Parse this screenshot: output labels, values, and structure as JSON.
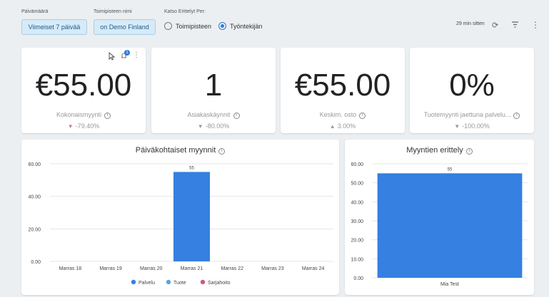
{
  "filters": {
    "date": {
      "label": "Päivämäärä",
      "value": "Viimeiset 7 päivää"
    },
    "location": {
      "label": "Toimipisteen nimi",
      "value": "on Demo Finland"
    },
    "breakdown": {
      "label": "Katso Erittelyt Per:",
      "options": [
        {
          "label": "Toimipisteen",
          "selected": false
        },
        {
          "label": "Työntekijän",
          "selected": true
        }
      ]
    },
    "updated": "29 min sitten"
  },
  "kpis": [
    {
      "value": "€55.00",
      "label": "Kokonaismyynti",
      "delta": "-79.40%",
      "direction": "down"
    },
    {
      "value": "1",
      "label": "Asiakaskäynnit",
      "delta": "-80.00%",
      "direction": "down"
    },
    {
      "value": "€55.00",
      "label": "Keskim. osto",
      "delta": "3.00%",
      "direction": "up"
    },
    {
      "value": "0%",
      "label": "Tuotemyynti jaettuna palvelu...",
      "delta": "-100.00%",
      "direction": "down"
    }
  ],
  "notification_count": "1",
  "colors": {
    "accent": "#2f7ad8",
    "bar": "#3580e0",
    "tuote": "#5aa4d8",
    "sarjahoito": "#c85a8a"
  },
  "chart_data": [
    {
      "type": "bar",
      "title": "Päiväkohtaiset myynnit",
      "categories": [
        "Marras 18",
        "Marras 19",
        "Marras 20",
        "Marras 21",
        "Marras 22",
        "Marras 23",
        "Marras 24"
      ],
      "series": [
        {
          "name": "Palvelu",
          "values": [
            0,
            0,
            0,
            55,
            0,
            0,
            0
          ]
        },
        {
          "name": "Tuote",
          "values": [
            0,
            0,
            0,
            0,
            0,
            0,
            0
          ]
        },
        {
          "name": "Sarjahoito",
          "values": [
            0,
            0,
            0,
            0,
            0,
            0,
            0
          ]
        }
      ],
      "data_labels": [
        "",
        "",
        "",
        "55",
        "",
        "",
        ""
      ],
      "yticks": [
        "0.00",
        "20.00",
        "40.00",
        "60.00"
      ],
      "ylim": [
        0,
        60
      ],
      "grid": true,
      "legend": "bottom"
    },
    {
      "type": "bar",
      "title": "Myyntien erittely",
      "categories": [
        "Mia Test"
      ],
      "values": [
        55
      ],
      "data_labels": [
        "55"
      ],
      "yticks": [
        "0.00",
        "10.00",
        "20.00",
        "30.00",
        "40.00",
        "50.00",
        "60.00"
      ],
      "ylim": [
        0,
        60
      ],
      "grid": true
    }
  ]
}
